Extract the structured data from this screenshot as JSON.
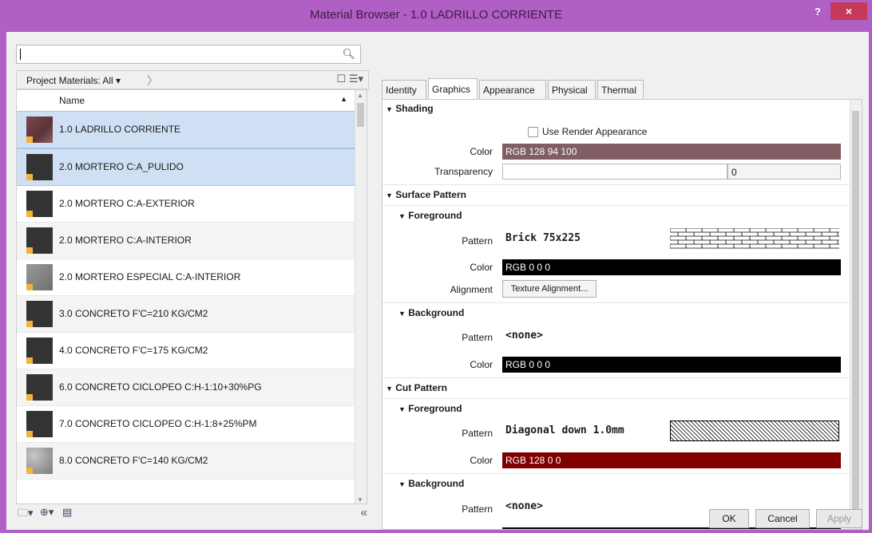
{
  "window": {
    "title": "Material Browser - 1.0 LADRILLO CORRIENTE",
    "help": "?",
    "close": "×"
  },
  "search": {
    "value": "",
    "icon": "search-icon"
  },
  "filter": {
    "label": "Project Materials: All"
  },
  "list": {
    "header": "Name",
    "items": [
      {
        "label": "1.0 LADRILLO CORRIENTE",
        "thumb": "brick"
      },
      {
        "label": "2.0 MORTERO C:A_PULIDO",
        "thumb": "dark"
      },
      {
        "label": "2.0 MORTERO C:A-EXTERIOR",
        "thumb": "dark"
      },
      {
        "label": "2.0 MORTERO C:A-INTERIOR",
        "thumb": "dark"
      },
      {
        "label": "2.0 MORTERO ESPECIAL C:A-INTERIOR",
        "thumb": "light"
      },
      {
        "label": "3.0 CONCRETO F'C=210 KG/CM2",
        "thumb": "dark"
      },
      {
        "label": "4.0 CONCRETO F'C=175 KG/CM2",
        "thumb": "dark"
      },
      {
        "label": "6.0 CONCRETO CICLOPEO C:H-1:10+30%PG",
        "thumb": "dark"
      },
      {
        "label": "7.0 CONCRETO CICLOPEO C:H-1:8+25%PM",
        "thumb": "dark"
      },
      {
        "label": "8.0 CONCRETO F'C=140 KG/CM2",
        "thumb": "speckle"
      }
    ]
  },
  "left_toolbar": {
    "collapse": "«"
  },
  "tabs": [
    "Identity",
    "Graphics",
    "Appearance",
    "Physical",
    "Thermal"
  ],
  "shading": {
    "title": "Shading",
    "use_render": "Use Render Appearance",
    "color_label": "Color",
    "color_value": "RGB 128 94 100",
    "color_hex": "#805e64",
    "transparency_label": "Transparency",
    "transparency_value": "0"
  },
  "surface": {
    "title": "Surface Pattern",
    "fg_title": "Foreground",
    "fg_pattern_label": "Pattern",
    "fg_pattern": "Brick 75x225",
    "fg_color_label": "Color",
    "fg_color": "RGB 0 0 0",
    "fg_color_hex": "#000000",
    "alignment_label": "Alignment",
    "alignment_btn": "Texture Alignment...",
    "bg_title": "Background",
    "bg_pattern_label": "Pattern",
    "bg_pattern": "<none>",
    "bg_color_label": "Color",
    "bg_color": "RGB 0 0 0",
    "bg_color_hex": "#000000"
  },
  "cut": {
    "title": "Cut Pattern",
    "fg_title": "Foreground",
    "fg_pattern_label": "Pattern",
    "fg_pattern": "Diagonal down 1.0mm",
    "fg_color_label": "Color",
    "fg_color": "RGB 128 0 0",
    "fg_color_hex": "#800000",
    "bg_title": "Background",
    "bg_pattern_label": "Pattern",
    "bg_pattern": "<none>"
  },
  "footer": {
    "ok": "OK",
    "cancel": "Cancel",
    "apply": "Apply"
  }
}
